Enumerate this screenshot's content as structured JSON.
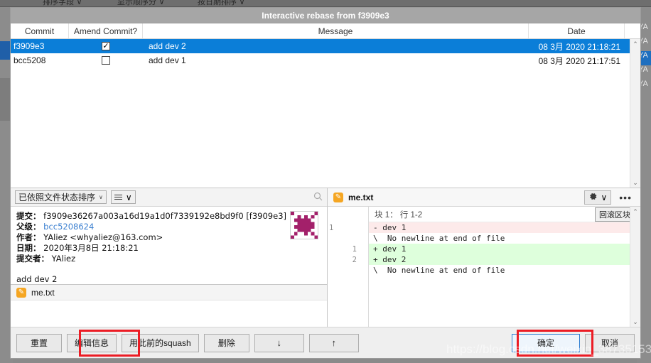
{
  "background": {
    "toolbar_items": [
      "排序字段 ∨",
      "显示顺序分 ∨",
      "按日期排序 ∨"
    ],
    "right_rows": [
      "YA",
      "YA",
      "YA",
      "YA",
      "YA"
    ]
  },
  "dialog": {
    "title": "Interactive rebase from f3909e3"
  },
  "commit_table": {
    "columns": [
      "Commit",
      "Amend Commit?",
      "Message",
      "Date"
    ],
    "rows": [
      {
        "commit": "f3909e3",
        "amend": true,
        "amend_mark": "✓",
        "message": "add dev 2",
        "date": "08 3月 2020 21:18:21",
        "selected": true
      },
      {
        "commit": "bcc5208",
        "amend": false,
        "amend_mark": "",
        "message": "add  dev 1",
        "date": "08 3月 2020 21:17:51",
        "selected": false
      }
    ],
    "scroll_up": "⌃",
    "scroll_down": "⌄"
  },
  "left_pane": {
    "sort_combo": "已依照文件状态排序",
    "caret": "∨",
    "menu_icon": "hamburger-icon",
    "search_icon": "search-icon",
    "detail": {
      "commit_label": "提交：",
      "commit_value": "f3909e36267a003a16d19a1d0f7339192e8bd9f0 [f3909e3]",
      "parent_label": "父级：",
      "parent_value": "bcc5208624",
      "author_label": "作者：",
      "author_value": "YAliez <whyaliez@163.com>",
      "date_label": "日期：",
      "date_value": "2020年3月8日 21:18:21",
      "committer_label": "提交者：",
      "committer_value": "YAliez",
      "message": "add dev 2"
    },
    "files": [
      {
        "name": "me.txt",
        "icon": "pencil-icon"
      }
    ]
  },
  "right_pane": {
    "file_name": "me.txt",
    "file_icon": "pencil-icon",
    "gear_icon": "gear-icon",
    "gear_caret": "∨",
    "more_icon": "more-dots-icon",
    "hunk_header": "块 1： 行 1-2",
    "rollback_label": "回滚区块",
    "diff_lines": [
      {
        "old": "1",
        "new": "",
        "type": "del",
        "text": "- dev 1"
      },
      {
        "old": "",
        "new": "",
        "type": "ctx",
        "text": "\\  No newline at end of file"
      },
      {
        "old": "",
        "new": "1",
        "type": "add",
        "text": "+ dev 1"
      },
      {
        "old": "",
        "new": "2",
        "type": "add",
        "text": "+ dev 2"
      },
      {
        "old": "",
        "new": "",
        "type": "ctx",
        "text": "\\  No newline at end of file"
      }
    ],
    "scroll_up": "⌃",
    "scroll_down": "⌄"
  },
  "footer": {
    "buttons": [
      {
        "label": "重置",
        "name": "reset-button",
        "highlight": false
      },
      {
        "label": "编辑信息",
        "name": "edit-message-button",
        "highlight": true
      },
      {
        "label": "用此前的squash",
        "name": "squash-button",
        "highlight": false
      },
      {
        "label": "删除",
        "name": "delete-button",
        "highlight": false
      },
      {
        "label": "↓",
        "name": "move-down-button",
        "highlight": false
      },
      {
        "label": "↑",
        "name": "move-up-button",
        "highlight": false
      }
    ],
    "ok_label": "确定",
    "cancel_label": "取消"
  },
  "watermark": "https://blog.csdn.net/weixin_38735153",
  "colors": {
    "selection_blue": "#0b7ed8",
    "title_bar": "#a6a6a6",
    "highlight_red": "#ec1c24",
    "diff_add": "#deffdc",
    "diff_del": "#fdeaea",
    "accent_orange": "#f5a623",
    "link_blue": "#3a7fd0"
  }
}
